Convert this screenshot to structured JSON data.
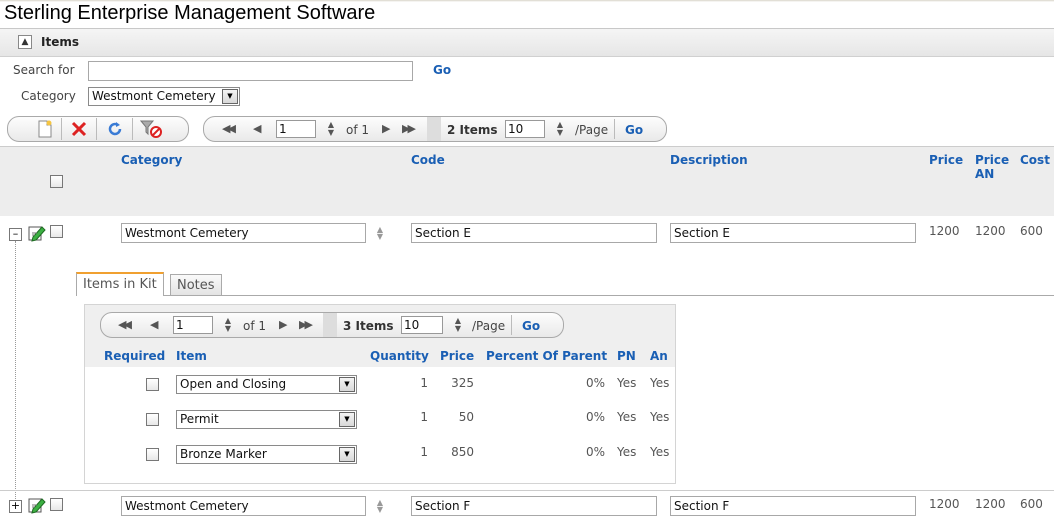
{
  "app": {
    "title": "Sterling Enterprise Management Software"
  },
  "section": {
    "title": "Items"
  },
  "search": {
    "label": "Search for",
    "value": "",
    "go": "Go"
  },
  "category_filter": {
    "label": "Category",
    "selected": "Westmont Cemetery"
  },
  "toolbar": {
    "icons": [
      "new-document-icon",
      "delete-icon",
      "refresh-icon",
      "clear-filter-icon"
    ]
  },
  "pager": {
    "page": "1",
    "of_text": "of 1",
    "count_text": "2 Items",
    "page_size": "10",
    "per_page": "/Page",
    "go": "Go"
  },
  "columns": {
    "category": "Category",
    "code": "Code",
    "description": "Description",
    "price": "Price",
    "price_an": "Price AN",
    "cost": "Cost"
  },
  "rows": [
    {
      "category": "Westmont Cemetery",
      "code": "Section E",
      "description": "Section E",
      "price": "1200",
      "price_an": "1200",
      "cost": "600",
      "expanded": true
    },
    {
      "category": "Westmont Cemetery",
      "code": "Section F",
      "description": "Section F",
      "price": "1200",
      "price_an": "1200",
      "cost": "600",
      "expanded": false
    }
  ],
  "detail_tabs": {
    "items_in_kit": "Items in Kit",
    "notes": "Notes"
  },
  "kit_pager": {
    "page": "1",
    "of_text": "of 1",
    "count_text": "3 Items",
    "page_size": "10",
    "per_page": "/Page",
    "go": "Go"
  },
  "kit_columns": {
    "required": "Required",
    "item": "Item",
    "quantity": "Quantity",
    "price": "Price",
    "percent": "Percent Of Parent",
    "pn": "PN",
    "an": "An"
  },
  "kit_rows": [
    {
      "item": "Open and Closing",
      "quantity": "1",
      "price": "325",
      "percent": "0%",
      "pn": "Yes",
      "an": "Yes"
    },
    {
      "item": "Permit",
      "quantity": "1",
      "price": "50",
      "percent": "0%",
      "pn": "Yes",
      "an": "Yes"
    },
    {
      "item": "Bronze Marker",
      "quantity": "1",
      "price": "850",
      "percent": "0%",
      "pn": "Yes",
      "an": "Yes"
    }
  ],
  "colors": {
    "link": "#1a5fb4",
    "header_bg": "#ededed",
    "active_tab": "#f0a030"
  }
}
